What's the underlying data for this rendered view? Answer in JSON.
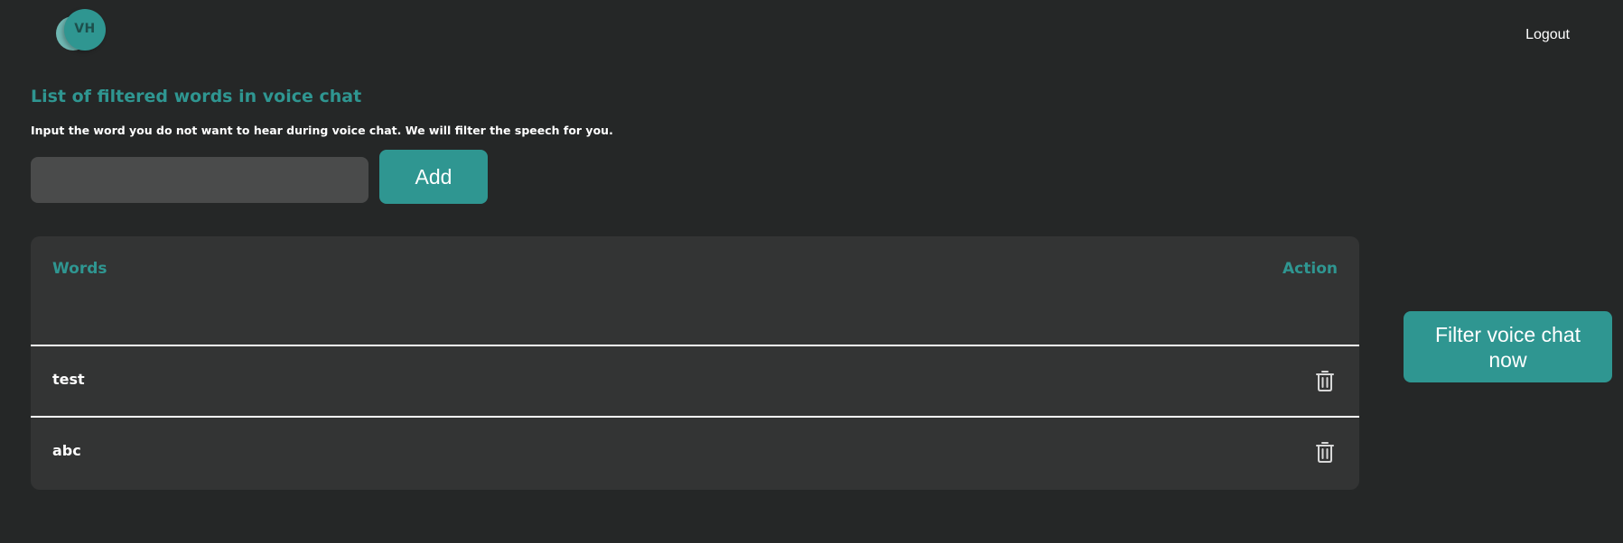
{
  "brand": {
    "logo_text": "VH"
  },
  "header": {
    "logout_label": "Logout"
  },
  "main": {
    "title": "List of filtered words in voice chat",
    "subtitle": "Input the word you do not want to hear during voice chat. We will filter the speech for you.",
    "word_input": {
      "value": "",
      "placeholder": ""
    },
    "add_label": "Add"
  },
  "table": {
    "columns": {
      "words": "Words",
      "action": "Action"
    },
    "rows": [
      {
        "word": "test",
        "action_icon": "trash-icon"
      },
      {
        "word": "abc",
        "action_icon": "trash-icon"
      }
    ]
  },
  "filter_button_label": "Filter voice chat now",
  "colors": {
    "background": "#252727",
    "accent": "#2f9691",
    "card": "#333434",
    "input": "#4a4b4b"
  }
}
